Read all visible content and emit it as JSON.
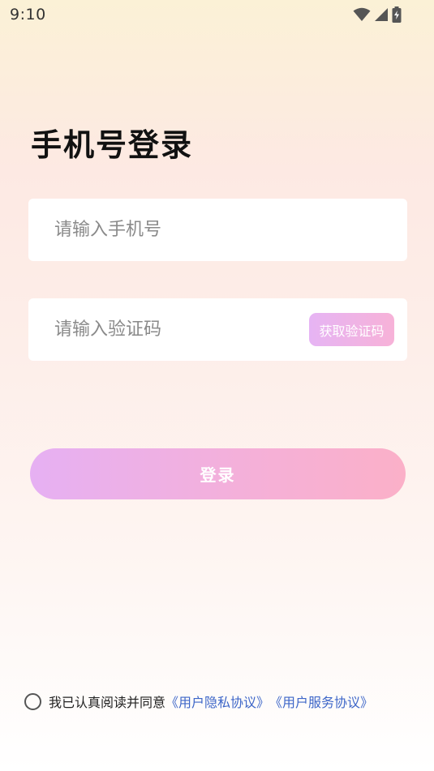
{
  "status_bar": {
    "time": "9:10",
    "icons": [
      "wifi-icon",
      "signal-icon",
      "battery-charging-icon"
    ]
  },
  "page": {
    "title": "手机号登录"
  },
  "form": {
    "phone_placeholder": "请输入手机号",
    "code_placeholder": "请输入验证码",
    "get_code_label": "获取验证码",
    "login_label": "登录"
  },
  "agreement": {
    "text": "我已认真阅读并同意",
    "privacy_link": "《用户隐私协议》",
    "service_link": "《用户服务协议》"
  },
  "colors": {
    "accent_gradient_start": "#e6b0f3",
    "accent_gradient_end": "#fbb0c8",
    "link": "#3d66c8"
  }
}
